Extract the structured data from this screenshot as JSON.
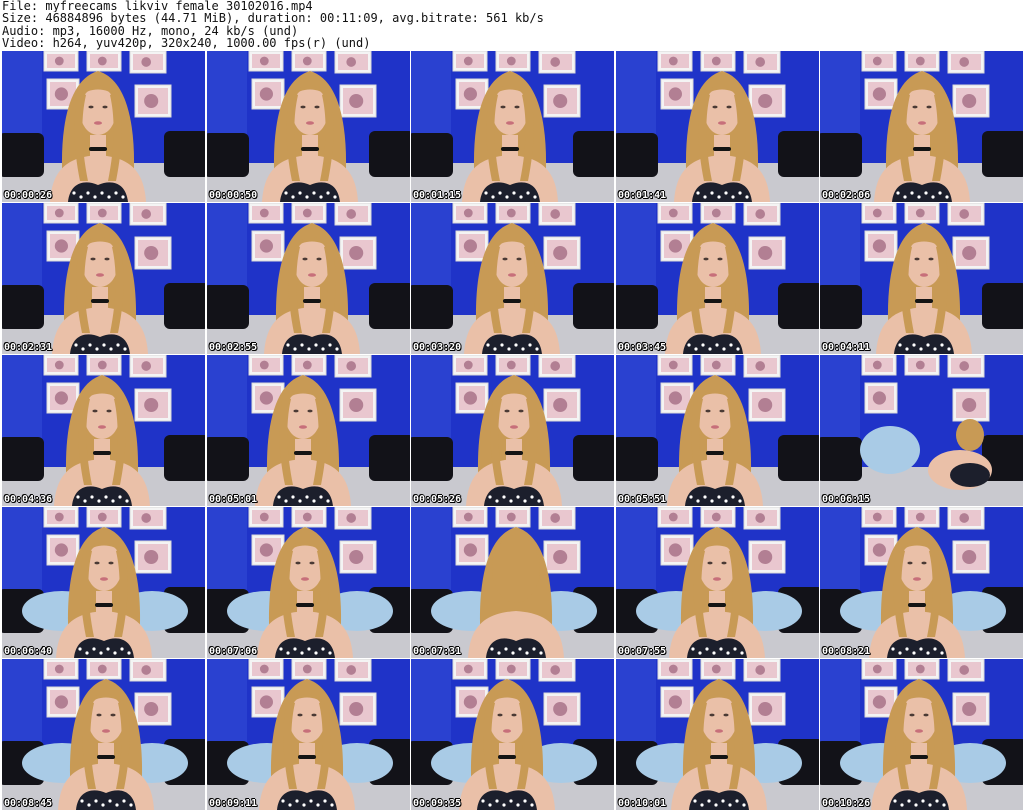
{
  "header": {
    "line1": "File: myfreecams_likviv_female_30102016.mp4",
    "line2": "Size: 46884896 bytes (44.71 MiB), duration: 00:11:09, avg.bitrate: 561 kb/s",
    "line3": "Audio: mp3, 16000 Hz, mono, 24 kb/s (und)",
    "line4": "Video: h264, yuv420p, 320x240, 1000.00 fps(r) (und)"
  },
  "grid": {
    "columns": 5,
    "rows": 5
  },
  "colors": {
    "wall": "#1f33c8",
    "wall_light": "#3f5be0",
    "hair": "#c89a55",
    "skin": "#eac0a8",
    "dark_cushion": "#121218",
    "floor": "#c9c9cf",
    "blue_cushion": "#a9cbe6"
  },
  "thumbnails": [
    {
      "timestamp": "00:00:26",
      "scene": "sitting"
    },
    {
      "timestamp": "00:00:50",
      "scene": "sitting"
    },
    {
      "timestamp": "00:01:15",
      "scene": "sitting"
    },
    {
      "timestamp": "00:01:41",
      "scene": "sitting"
    },
    {
      "timestamp": "00:02:06",
      "scene": "sitting"
    },
    {
      "timestamp": "00:02:31",
      "scene": "sitting"
    },
    {
      "timestamp": "00:02:55",
      "scene": "sitting"
    },
    {
      "timestamp": "00:03:20",
      "scene": "sitting"
    },
    {
      "timestamp": "00:03:45",
      "scene": "sitting"
    },
    {
      "timestamp": "00:04:11",
      "scene": "sitting"
    },
    {
      "timestamp": "00:04:36",
      "scene": "sitting"
    },
    {
      "timestamp": "00:05:01",
      "scene": "sitting"
    },
    {
      "timestamp": "00:05:26",
      "scene": "sitting"
    },
    {
      "timestamp": "00:05:51",
      "scene": "sitting"
    },
    {
      "timestamp": "00:06:15",
      "scene": "away"
    },
    {
      "timestamp": "00:06:40",
      "scene": "sitting-cushion"
    },
    {
      "timestamp": "00:07:06",
      "scene": "sitting-cushion"
    },
    {
      "timestamp": "00:07:31",
      "scene": "turned-cushion"
    },
    {
      "timestamp": "00:07:55",
      "scene": "sitting-cushion"
    },
    {
      "timestamp": "00:08:21",
      "scene": "sitting-cushion"
    },
    {
      "timestamp": "00:08:45",
      "scene": "sitting-cushion"
    },
    {
      "timestamp": "00:09:11",
      "scene": "sitting-cushion"
    },
    {
      "timestamp": "00:09:35",
      "scene": "sitting-cushion"
    },
    {
      "timestamp": "00:10:01",
      "scene": "sitting-cushion"
    },
    {
      "timestamp": "00:10:26",
      "scene": "sitting-cushion"
    }
  ]
}
